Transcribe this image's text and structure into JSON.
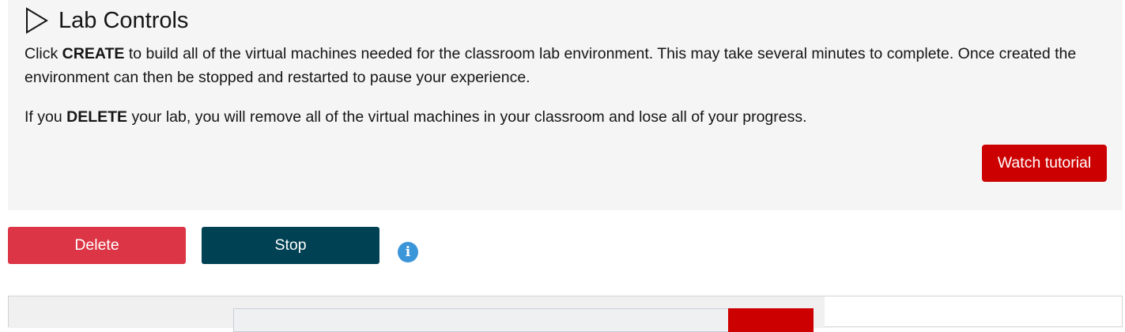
{
  "panel": {
    "title": "Lab Controls",
    "title_icon": "play-outline-icon",
    "paragraph1": {
      "before": "Click ",
      "bold": "CREATE",
      "after": " to build all of the virtual machines needed for the classroom lab environment. This may take several minutes to complete. Once created the environment can then be stopped and restarted to pause your experience."
    },
    "paragraph2": {
      "before": "If you ",
      "bold": "DELETE",
      "after": " your lab, you will remove all of the virtual machines in your classroom and lose all of your progress."
    },
    "watch_tutorial_label": "Watch tutorial"
  },
  "controls": {
    "delete_label": "Delete",
    "stop_label": "Stop",
    "info_icon": "info-icon",
    "info_glyph": "i"
  },
  "colors": {
    "panel_bg": "#f5f5f5",
    "watch_tutorial": "#cc0000",
    "delete": "#dc3545",
    "stop": "#004153",
    "info": "#3b95d9"
  }
}
